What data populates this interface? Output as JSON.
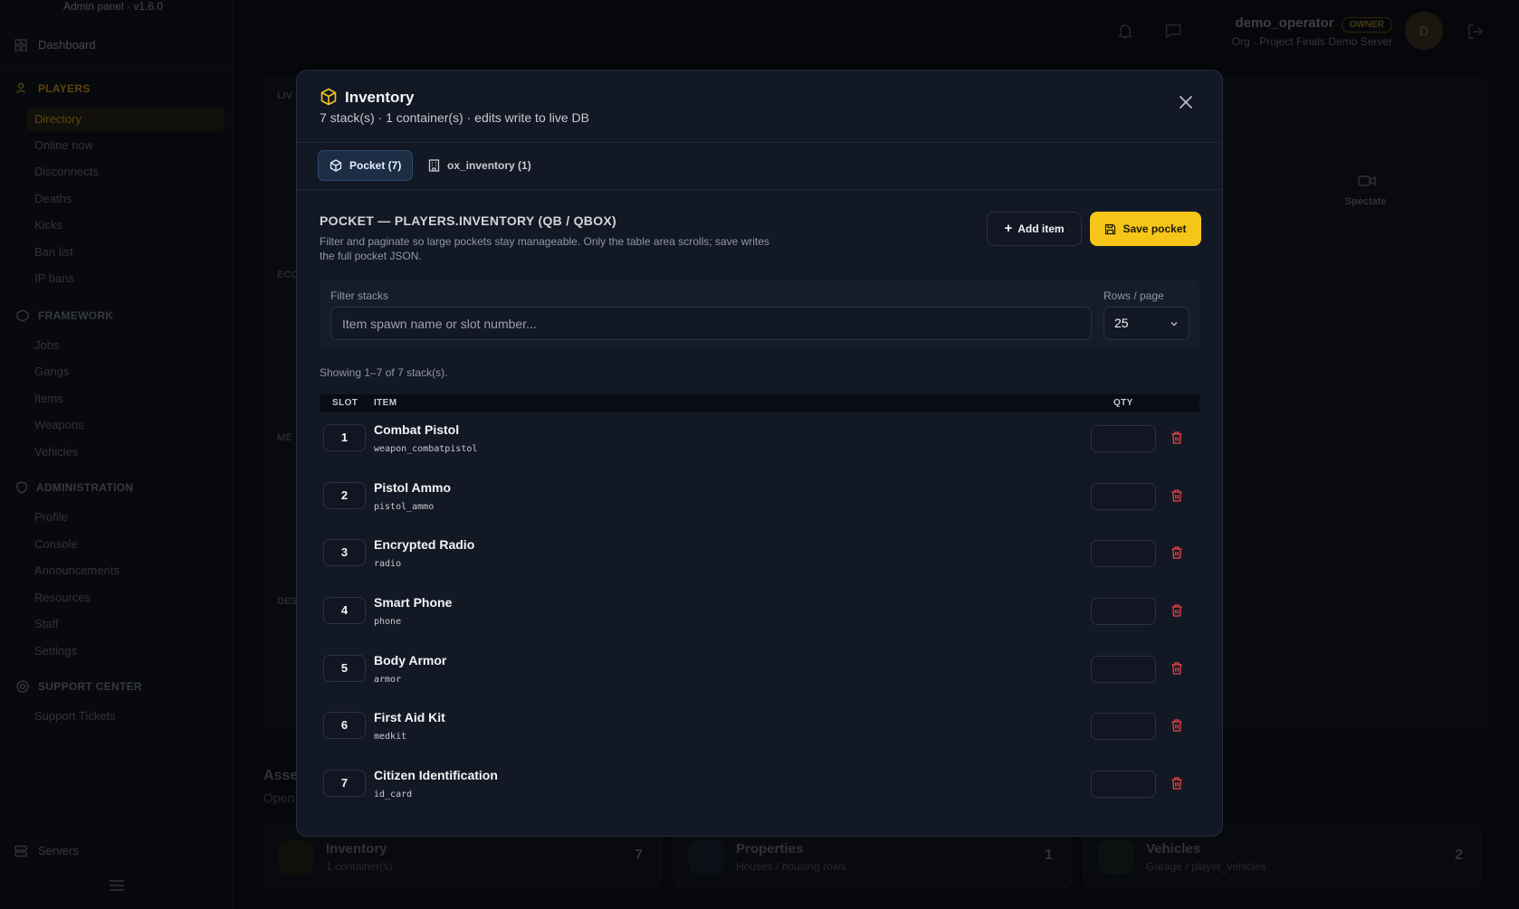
{
  "app": {
    "version_label": "Admin panel · v1.6.0",
    "dashboard_label": "Dashboard"
  },
  "sidebar": {
    "sections": [
      {
        "label": "PLAYERS",
        "items": [
          "Directory",
          "Online now",
          "Disconnects",
          "Deaths",
          "Kicks",
          "Ban list",
          "IP bans"
        ]
      },
      {
        "label": "FRAMEWORK",
        "items": [
          "Jobs",
          "Gangs",
          "Items",
          "Weapons",
          "Vehicles"
        ]
      },
      {
        "label": "ADMINISTRATION",
        "items": [
          "Profile",
          "Console",
          "Announcements",
          "Resources",
          "Staff",
          "Settings"
        ]
      },
      {
        "label": "SUPPORT CENTER",
        "items": [
          "Support Tickets"
        ]
      }
    ],
    "servers_label": "Servers"
  },
  "topbar": {
    "username": "demo_operator",
    "badge": "OWNER",
    "org": "Org · Project Finals Demo Server",
    "avatar_initial": "D"
  },
  "background": {
    "spectate_label": "Spectate",
    "section_labels": [
      "LIV",
      "ECO",
      "ME",
      "DES"
    ],
    "assets_title": "Asse",
    "assets_sub": "Open",
    "assets": [
      {
        "title": "Inventory",
        "sub": "1 container(s)",
        "count": "7"
      },
      {
        "title": "Properties",
        "sub": "Houses / housing rows",
        "count": "1"
      },
      {
        "title": "Vehicles",
        "sub": "Garage / player_vehicles",
        "count": "2"
      }
    ]
  },
  "modal": {
    "title": "Inventory",
    "subtitle": "7 stack(s) · 1 container(s) · edits write to live DB",
    "tabs": [
      {
        "label": "Pocket (7)"
      },
      {
        "label": "ox_inventory (1)"
      }
    ],
    "section_title": "POCKET — PLAYERS.INVENTORY (QB / QBOX)",
    "section_desc": "Filter and paginate so large pockets stay manageable. Only the table area scrolls; save writes the full pocket JSON.",
    "add_item_label": "Add item",
    "save_label": "Save pocket",
    "filter_label": "Filter stacks",
    "filter_placeholder": "Item spawn name or slot number...",
    "rows_label": "Rows / page",
    "rows_value": "25",
    "showing": "Showing 1–7 of 7 stack(s).",
    "columns": {
      "slot": "SLOT",
      "item": "ITEM",
      "qty": "QTY"
    },
    "items": [
      {
        "slot": "1",
        "name": "Combat Pistol",
        "spawn": "weapon_combatpistol"
      },
      {
        "slot": "2",
        "name": "Pistol Ammo",
        "spawn": "pistol_ammo"
      },
      {
        "slot": "3",
        "name": "Encrypted Radio",
        "spawn": "radio"
      },
      {
        "slot": "4",
        "name": "Smart Phone",
        "spawn": "phone"
      },
      {
        "slot": "5",
        "name": "Body Armor",
        "spawn": "armor"
      },
      {
        "slot": "6",
        "name": "First Aid Kit",
        "spawn": "medkit"
      },
      {
        "slot": "7",
        "name": "Citizen Identification",
        "spawn": "id_card"
      }
    ]
  },
  "colors": {
    "accent": "#f5c518",
    "danger": "#ef4444",
    "tab_active": "#1c2d45"
  }
}
